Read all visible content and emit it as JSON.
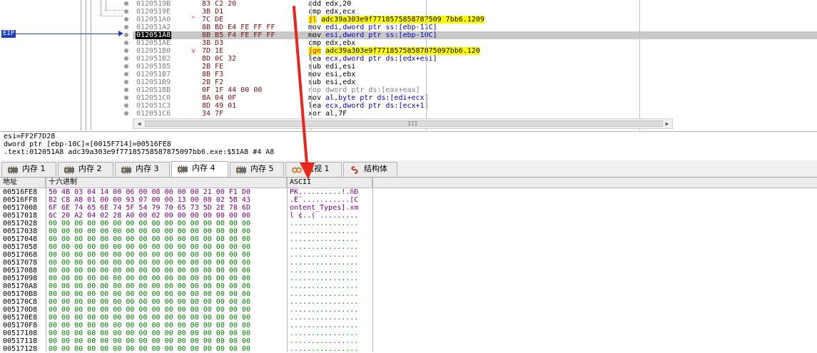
{
  "disasm": {
    "eip_label": "EIP",
    "rows": [
      {
        "addr": "0120519B",
        "jmp": "",
        "bytes": "83 C2 20",
        "mnem": "add",
        "ops": "edx,20",
        "kind": "plain"
      },
      {
        "addr": "0120519E",
        "jmp": "",
        "bytes": "3B D1",
        "mnem": "cmp",
        "ops": "edx,ecx",
        "kind": "plain"
      },
      {
        "addr": "012051A0",
        "jmp": "^",
        "bytes": "7C DE",
        "mnem": "jl",
        "ops": "adc39a303e9f7718575858787509 7bb6.1209",
        "kind": "jump"
      },
      {
        "addr": "012051A2",
        "jmp": "",
        "bytes": "8B BD E4 FE FF FF",
        "mnem": "mov",
        "ops": "edi,dword ptr ss:[ebp-11C]",
        "kind": "mem"
      },
      {
        "addr": "012051A8",
        "jmp": "",
        "bytes": "8B B5 F4 FE FF FF",
        "mnem": "mov",
        "ops": "esi,dword ptr ss:[ebp-10C]",
        "kind": "mem",
        "current": true
      },
      {
        "addr": "012051AE",
        "jmp": "",
        "bytes": "3B D3",
        "mnem": "cmp",
        "ops": "edx,ebx",
        "kind": "plain"
      },
      {
        "addr": "012051B0",
        "jmp": "v",
        "bytes": "7D 1E",
        "mnem": "jge",
        "ops": "adc39a303e9f77185758587875097bb6.120",
        "kind": "jump"
      },
      {
        "addr": "012051B2",
        "jmp": "",
        "bytes": "8D 0C 32",
        "mnem": "lea",
        "ops": "ecx,dword ptr ds:[edx+esi]",
        "kind": "ds"
      },
      {
        "addr": "012051B5",
        "jmp": "",
        "bytes": "2B FE",
        "mnem": "sub",
        "ops": "edi,esi",
        "kind": "plain"
      },
      {
        "addr": "012051B7",
        "jmp": "",
        "bytes": "8B F3",
        "mnem": "mov",
        "ops": "esi,ebx",
        "kind": "plain"
      },
      {
        "addr": "012051B9",
        "jmp": "",
        "bytes": "2B F2",
        "mnem": "sub",
        "ops": "esi,edx",
        "kind": "plain"
      },
      {
        "addr": "012051BB",
        "jmp": "",
        "bytes": "0F 1F 44 00 00",
        "mnem": "nop",
        "ops": "dword ptr ds:[eax+eax]",
        "kind": "nop"
      },
      {
        "addr": "012051C0",
        "jmp": "",
        "bytes": "8A 04 0F",
        "mnem": "mov",
        "ops": "al,byte ptr ds:[edi+ecx]",
        "kind": "ds"
      },
      {
        "addr": "012051C3",
        "jmp": "",
        "bytes": "8D 49 01",
        "mnem": "lea",
        "ops": "ecx,dword ptr ds:[ecx+1]",
        "kind": "ds"
      },
      {
        "addr": "012051C6",
        "jmp": "",
        "bytes": "34 7F",
        "mnem": "xor",
        "ops": "al,7F",
        "kind": "plain"
      }
    ],
    "scroll_grip": "III"
  },
  "info": {
    "line1": "esi=FF2F7D28",
    "line2": "dword ptr [ebp-10C]=[0015F714]=00516FE8",
    "line3": ".text:012051A8 adc39a303e9f77185758587875097bb6.exe:$51A8 #4 A8"
  },
  "tabs": [
    {
      "label": "内存 1",
      "icon": "memory-icon",
      "active": false
    },
    {
      "label": "内存 2",
      "icon": "memory-icon",
      "active": false
    },
    {
      "label": "内存 3",
      "icon": "memory-icon",
      "active": false
    },
    {
      "label": "内存 4",
      "icon": "memory-icon",
      "active": true
    },
    {
      "label": "内存 5",
      "icon": "memory-icon",
      "active": false
    },
    {
      "label": "监视 1",
      "icon": "watch-icon",
      "active": false
    },
    {
      "label": "结构体",
      "icon": "struct-icon",
      "active": false
    }
  ],
  "dump": {
    "headers": {
      "address": "地址",
      "hex": "十六进制",
      "ascii": "ASCII"
    },
    "rows": [
      {
        "addr": "00516FE8",
        "hex": "50 4B 03 04 14 00 06 00 08 00 00 00 21 00 F1 D0",
        "ascii": "PK..........!.ñÐ"
      },
      {
        "addr": "00516FF8",
        "hex": "82 C8 A8 01 00 00 93 07 00 00 13 00 08 02 5B 43",
        "ascii": ".È¨...........[C"
      },
      {
        "addr": "00517008",
        "hex": "6F 6E 74 65 6E 74 5F 54 79 70 65 73 5D 2E 78 6D",
        "ascii": "ontent_Types].xm"
      },
      {
        "addr": "00517018",
        "hex": "6C 20 A2 04 02 28 A0 00 02 00 00 00 00 00 00 00",
        "ascii": "l ¢..( ........."
      },
      {
        "addr": "00517028",
        "hex": "00 00 00 00 00 00 00 00 00 00 00 00 00 00 00 00",
        "ascii": "................"
      },
      {
        "addr": "00517038",
        "hex": "00 00 00 00 00 00 00 00 00 00 00 00 00 00 00 00",
        "ascii": "................"
      },
      {
        "addr": "00517048",
        "hex": "00 00 00 00 00 00 00 00 00 00 00 00 00 00 00 00",
        "ascii": "................"
      },
      {
        "addr": "00517058",
        "hex": "00 00 00 00 00 00 00 00 00 00 00 00 00 00 00 00",
        "ascii": "................"
      },
      {
        "addr": "00517068",
        "hex": "00 00 00 00 00 00 00 00 00 00 00 00 00 00 00 00",
        "ascii": "................"
      },
      {
        "addr": "00517078",
        "hex": "00 00 00 00 00 00 00 00 00 00 00 00 00 00 00 00",
        "ascii": "................"
      },
      {
        "addr": "00517088",
        "hex": "00 00 00 00 00 00 00 00 00 00 00 00 00 00 00 00",
        "ascii": "................"
      },
      {
        "addr": "00517098",
        "hex": "00 00 00 00 00 00 00 00 00 00 00 00 00 00 00 00",
        "ascii": "................"
      },
      {
        "addr": "005170A8",
        "hex": "00 00 00 00 00 00 00 00 00 00 00 00 00 00 00 00",
        "ascii": "................"
      },
      {
        "addr": "005170B8",
        "hex": "00 00 00 00 00 00 00 00 00 00 00 00 00 00 00 00",
        "ascii": "................"
      },
      {
        "addr": "005170C8",
        "hex": "00 00 00 00 00 00 00 00 00 00 00 00 00 00 00 00",
        "ascii": "................"
      },
      {
        "addr": "005170D8",
        "hex": "00 00 00 00 00 00 00 00 00 00 00 00 00 00 00 00",
        "ascii": "................"
      },
      {
        "addr": "005170E8",
        "hex": "00 00 00 00 00 00 00 00 00 00 00 00 00 00 00 00",
        "ascii": "................"
      },
      {
        "addr": "005170F8",
        "hex": "00 00 00 00 00 00 00 00 00 00 00 00 00 00 00 00",
        "ascii": "................"
      },
      {
        "addr": "00517108",
        "hex": "00 00 00 00 00 00 00 00 00 00 00 00 00 00 00 00",
        "ascii": "................"
      },
      {
        "addr": "00517118",
        "hex": "00 00 00 00 00 00 00 00 00 00 00 00 00 00 00 00",
        "ascii": "................"
      },
      {
        "addr": "00517128",
        "hex": "00 00 00 00 00 00 00 00 00 00 00 00 00 00 00 00",
        "ascii": "................"
      }
    ]
  },
  "colors": {
    "eip": "#1f3fbf",
    "annotation_arrow": "#e8261c",
    "highlight_yellow": "#ffff00",
    "highlight_cyan": "#00ffff"
  }
}
